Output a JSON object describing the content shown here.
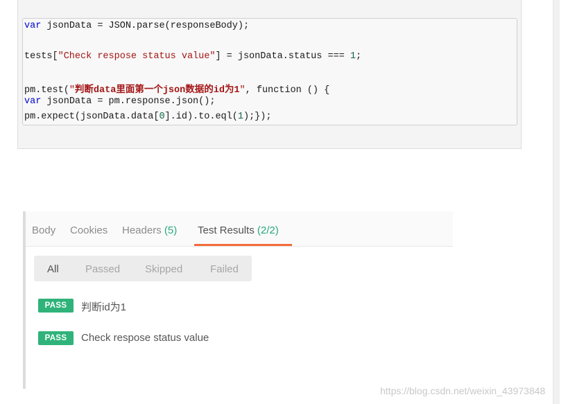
{
  "code": {
    "line1": {
      "kw": "var",
      "rest": " jsonData = JSON.parse(responseBody);"
    },
    "line2": {
      "pre": "tests[",
      "str": "\"Check respose status value\"",
      "mid": "] = jsonData.status === ",
      "num": "1",
      "post": ";"
    },
    "line3": {
      "pre": "pm.test(",
      "q1": "\"",
      "bold1": "判断data里面第一个json数据的id为1",
      "q2": "\"",
      "post": ", function () {"
    },
    "line4": {
      "kw": "var",
      "rest": " jsonData = pm.response.json();"
    },
    "line5": {
      "pre": "pm.expect(jsonData.data[",
      "num1": "0",
      "mid": "].id).to.eql(",
      "num2": "1",
      "post": ");});"
    }
  },
  "tabs": {
    "body": "Body",
    "cookies": "Cookies",
    "headers": "Headers",
    "headers_count": "(5)",
    "test_results": "Test Results",
    "test_results_count": "(2/2)"
  },
  "filters": {
    "all": "All",
    "passed": "Passed",
    "skipped": "Skipped",
    "failed": "Failed"
  },
  "results": [
    {
      "status": "PASS",
      "name": "判断id为1"
    },
    {
      "status": "PASS",
      "name": "Check respose status value"
    }
  ],
  "watermark": "https://blog.csdn.net/weixin_43973848",
  "colors": {
    "pass": "#2fb37a",
    "active_tab_underline": "#f26b3a",
    "count": "#2aa87a",
    "keyword": "#0000cc",
    "string": "#a31515"
  }
}
